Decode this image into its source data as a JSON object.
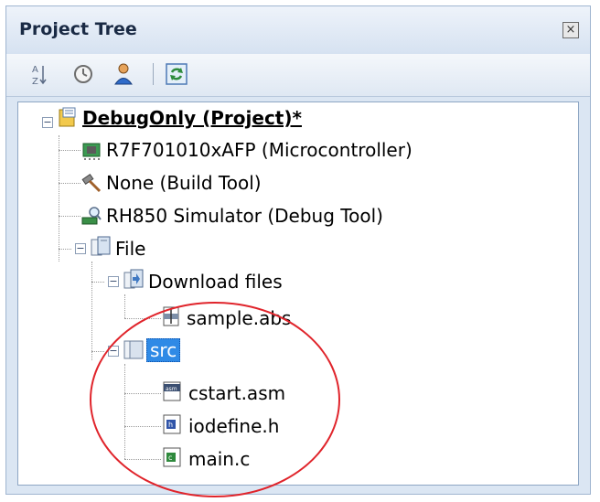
{
  "panel": {
    "title": "Project Tree",
    "close_symbol": "×"
  },
  "toolbar": {
    "buttons": [
      {
        "name": "sort-icon"
      },
      {
        "name": "property-icon"
      },
      {
        "name": "member-icon"
      },
      {
        "name": "refresh-icon"
      }
    ]
  },
  "tree": {
    "project": "DebugOnly (Project)*",
    "microcontroller": "R7F701010xAFP (Microcontroller)",
    "build_tool": "None (Build Tool)",
    "debug_tool": "RH850 Simulator (Debug Tool)",
    "file_category": "File",
    "download_files": "Download files",
    "sample": "sample.abs",
    "src": "src",
    "cstart": "cstart.asm",
    "iodefine": "iodefine.h",
    "main": "main.c"
  },
  "colors": {
    "selection": "#2f8ae6",
    "annotation_circle": "#e0242b"
  }
}
